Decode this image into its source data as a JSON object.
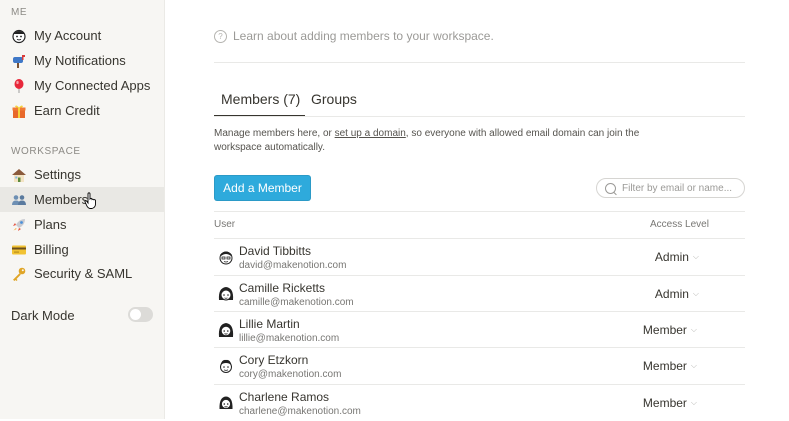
{
  "sidebar": {
    "me_label": "ME",
    "me_items": [
      {
        "label": "My Account",
        "icon": "avatar-icon"
      },
      {
        "label": "My Notifications",
        "icon": "mailbox-icon"
      },
      {
        "label": "My Connected Apps",
        "icon": "balloon-icon"
      },
      {
        "label": "Earn Credit",
        "icon": "gift-icon"
      }
    ],
    "workspace_label": "WORKSPACE",
    "workspace_items": [
      {
        "label": "Settings",
        "icon": "house-icon"
      },
      {
        "label": "Members",
        "icon": "people-icon",
        "active": true
      },
      {
        "label": "Plans",
        "icon": "rocket-icon"
      },
      {
        "label": "Billing",
        "icon": "credit-card-icon"
      },
      {
        "label": "Security & SAML",
        "icon": "key-icon"
      }
    ],
    "dark_mode_label": "Dark Mode",
    "dark_mode_on": false
  },
  "main": {
    "learn_link": "Learn about adding members to your workspace.",
    "tabs": [
      {
        "label": "Members (7)",
        "active": true
      },
      {
        "label": "Groups",
        "active": false
      }
    ],
    "description_prefix": "Manage members here, or ",
    "description_link": "set up a domain",
    "description_suffix": ", so everyone with allowed email domain can join the workspace automatically.",
    "add_button": "Add a Member",
    "filter_placeholder": "Filter by email or name...",
    "table": {
      "col_user": "User",
      "col_access": "Access Level",
      "rows": [
        {
          "name": "David Tibbitts",
          "email": "david@makenotion.com",
          "level": "Admin"
        },
        {
          "name": "Camille Ricketts",
          "email": "camille@makenotion.com",
          "level": "Admin"
        },
        {
          "name": "Lillie Martin",
          "email": "lillie@makenotion.com",
          "level": "Member"
        },
        {
          "name": "Cory Etzkorn",
          "email": "cory@makenotion.com",
          "level": "Member"
        },
        {
          "name": "Charlene Ramos",
          "email": "charlene@makenotion.com",
          "level": "Member"
        }
      ]
    }
  },
  "colors": {
    "accent": "#2eaadc",
    "sidebar_bg": "#f7f6f3",
    "text": "#37352f"
  }
}
